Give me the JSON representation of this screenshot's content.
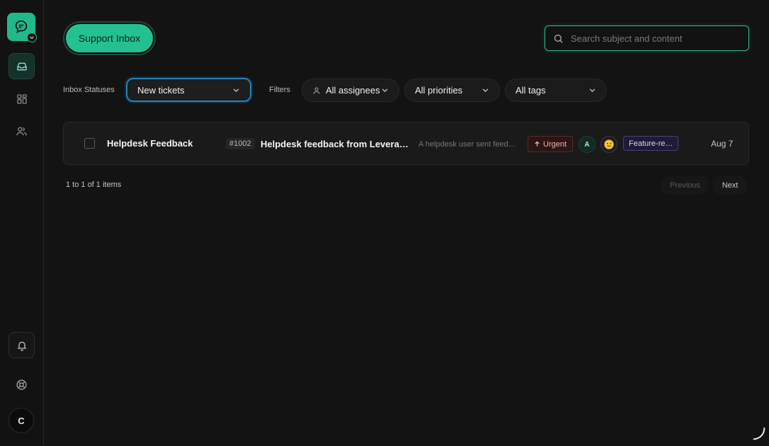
{
  "header": {
    "inbox_button": "Support Inbox",
    "search_placeholder": "Search subject and content"
  },
  "sidebar": {
    "user_initial": "C"
  },
  "filters": {
    "statuses_label": "Inbox Statuses",
    "status_value": "New tickets",
    "filters_label": "Filters",
    "assignees": "All assignees",
    "priorities": "All priorities",
    "tags": "All tags"
  },
  "tickets": [
    {
      "name": "Helpdesk Feedback",
      "id": "#1002",
      "subject": "Helpdesk feedback from Leverage…",
      "preview": "A helpdesk user sent feed…",
      "priority": "Urgent",
      "assignee_initial": "A",
      "tag": "Feature-re…",
      "date": "Aug 7"
    }
  ],
  "pagination": {
    "info": "1 to 1 of 1 items",
    "previous": "Previous",
    "next": "Next"
  },
  "colors": {
    "accent": "#25c08f",
    "focus_blue": "#2a7fb7",
    "urgent": "#5a2a2a",
    "tag": "#4a3f7a"
  }
}
